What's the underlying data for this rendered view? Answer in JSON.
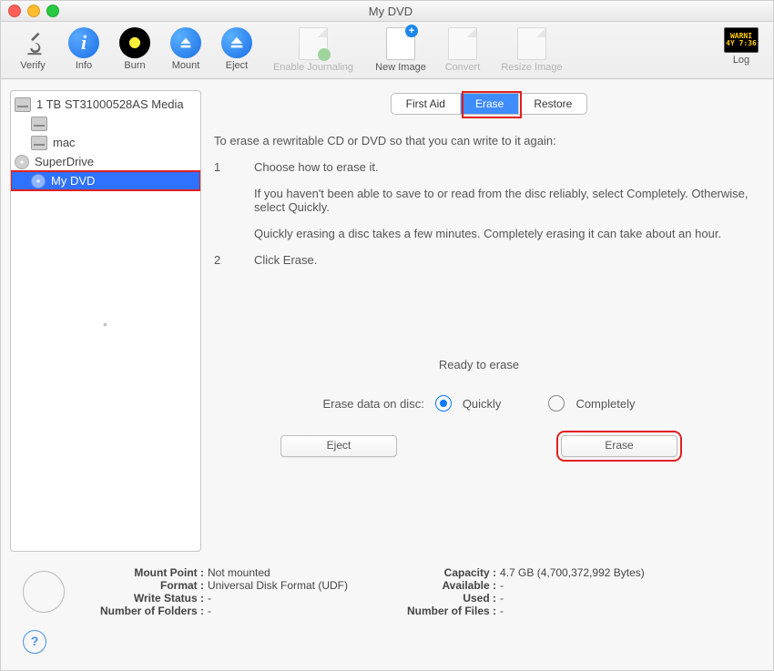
{
  "window": {
    "title": "My DVD"
  },
  "toolbar": {
    "verify": "Verify",
    "info": "Info",
    "burn": "Burn",
    "mount": "Mount",
    "eject": "Eject",
    "enable_journaling": "Enable Journaling",
    "new_image": "New Image",
    "convert": "Convert",
    "resize_image": "Resize Image",
    "log": "Log",
    "log_badge1": "WARNI",
    "log_badge2": "4Y 7:36"
  },
  "sidebar": {
    "items": [
      {
        "label": "1 TB ST31000528AS Media"
      },
      {
        "label": ""
      },
      {
        "label": "mac"
      },
      {
        "label": "SuperDrive"
      },
      {
        "label": "My DVD"
      }
    ]
  },
  "tabs": {
    "first_aid": "First Aid",
    "erase": "Erase",
    "restore": "Restore"
  },
  "content": {
    "intro": "To erase a rewritable CD or DVD so that you can write to it again:",
    "step1_num": "1",
    "step1": "Choose how to erase it.",
    "step1a": "If you haven't been able to save to or read from the disc reliably, select Completely. Otherwise, select Quickly.",
    "step1b": "Quickly erasing a disc takes a few minutes. Completely erasing it can take about an hour.",
    "step2_num": "2",
    "step2": "Click Erase.",
    "ready": "Ready to erase",
    "erase_data_on_disc": "Erase data on disc:",
    "quickly": "Quickly",
    "completely": "Completely",
    "eject_btn": "Eject",
    "erase_btn": "Erase"
  },
  "footer": {
    "mount_point_k": "Mount Point :",
    "mount_point_v": "Not mounted",
    "format_k": "Format :",
    "format_v": "Universal Disk Format (UDF)",
    "write_status_k": "Write Status :",
    "write_status_v": "-",
    "num_folders_k": "Number of Folders :",
    "num_folders_v": "-",
    "capacity_k": "Capacity :",
    "capacity_v": "4.7 GB (4,700,372,992 Bytes)",
    "available_k": "Available :",
    "available_v": "-",
    "used_k": "Used :",
    "used_v": "-",
    "num_files_k": "Number of Files :",
    "num_files_v": "-",
    "help": "?"
  }
}
